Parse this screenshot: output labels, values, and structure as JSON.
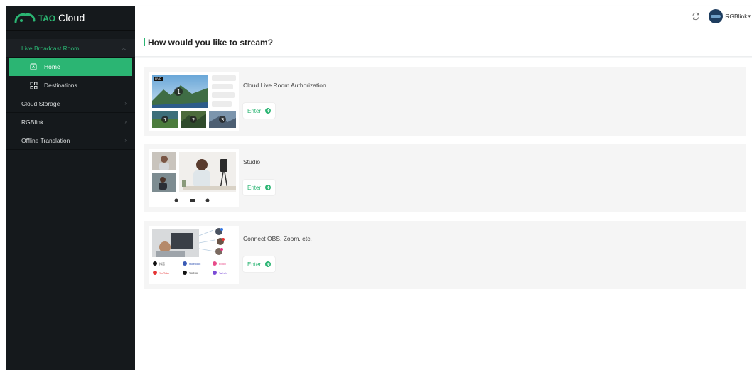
{
  "brand": {
    "logo_tao": "TAO",
    "logo_name": "Cloud"
  },
  "sidebar": {
    "groups": [
      {
        "label": "Live Broadcast Room",
        "open": true,
        "items": [
          {
            "label": "Home",
            "icon": "home-icon",
            "active": true
          },
          {
            "label": "Destinations",
            "icon": "destinations-icon",
            "active": false
          }
        ]
      },
      {
        "label": "Cloud Storage",
        "open": false
      },
      {
        "label": "RGBlink",
        "open": false
      },
      {
        "label": "Offline Translation",
        "open": false
      }
    ]
  },
  "topbar": {
    "user_name": "RGBlink",
    "refresh_icon": "refresh-icon"
  },
  "main": {
    "heading": "How would you like to stream?",
    "cards": [
      {
        "title": "Cloud Live Room Authorization",
        "enter_label": "Enter",
        "thumb": "multiview-thumbnail"
      },
      {
        "title": "Studio",
        "enter_label": "Enter",
        "thumb": "studio-thumbnail"
      },
      {
        "title": "Connect OBS, Zoom, etc.",
        "enter_label": "Enter",
        "thumb": "platforms-thumbnail"
      }
    ],
    "thumb_texts": {
      "live_tag": "LIVE",
      "multiview_numbers": [
        "1",
        "1",
        "2",
        "3"
      ],
      "platforms": [
        "抖音",
        "Facebook",
        "bilibili",
        "YouTube",
        "TIKTOK",
        "Twitch"
      ]
    }
  },
  "colors": {
    "accent": "#2bb573",
    "sidebar_bg": "#15191c",
    "card_bg": "#f5f5f5"
  }
}
